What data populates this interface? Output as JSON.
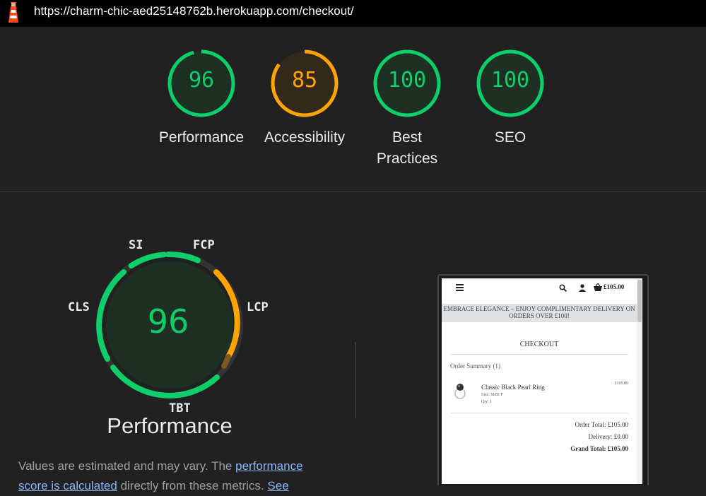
{
  "url": "https://charm-chic-aed25148762b.herokuapp.com/checkout/",
  "scores": [
    {
      "value": "96",
      "label": "Performance",
      "color": "#0cce6b",
      "fraction": 0.96
    },
    {
      "value": "85",
      "label": "Accessibility",
      "color": "#ffa400",
      "fraction": 0.85
    },
    {
      "value": "100",
      "label": "Best Practices",
      "color": "#0cce6b",
      "fraction": 1.0
    },
    {
      "value": "100",
      "label": "SEO",
      "color": "#0cce6b",
      "fraction": 1.0
    }
  ],
  "performance": {
    "score": "96",
    "title": "Performance",
    "metrics": {
      "si": "SI",
      "fcp": "FCP",
      "lcp": "LCP",
      "tbt": "TBT",
      "cls": "CLS"
    },
    "description_before": "Values are estimated and may vary. The ",
    "description_link": "performance score is calculated",
    "description_after": " directly from these metrics. ",
    "description_link2": "See"
  },
  "preview": {
    "cart_total": "£105.00",
    "banner": "EMBRACE ELEGANCE – ENJOY COMPLIMENTARY DELIVERY ON ORDERS OVER £100!",
    "heading": "CHECKOUT",
    "order_summary": "Order Summary (1)",
    "item_name": "Classic Black Pearl Ring",
    "item_size": "Size: SIZE F",
    "item_qty": "Qty: 1",
    "item_price": "£105.00",
    "order_total": "Order Total: £105.00",
    "delivery": "Delivery: £0.00",
    "grand_total": "Grand Total: £105.00"
  },
  "colors": {
    "pass": "#0cce6b",
    "average": "#ffa400",
    "background": "#212121"
  }
}
